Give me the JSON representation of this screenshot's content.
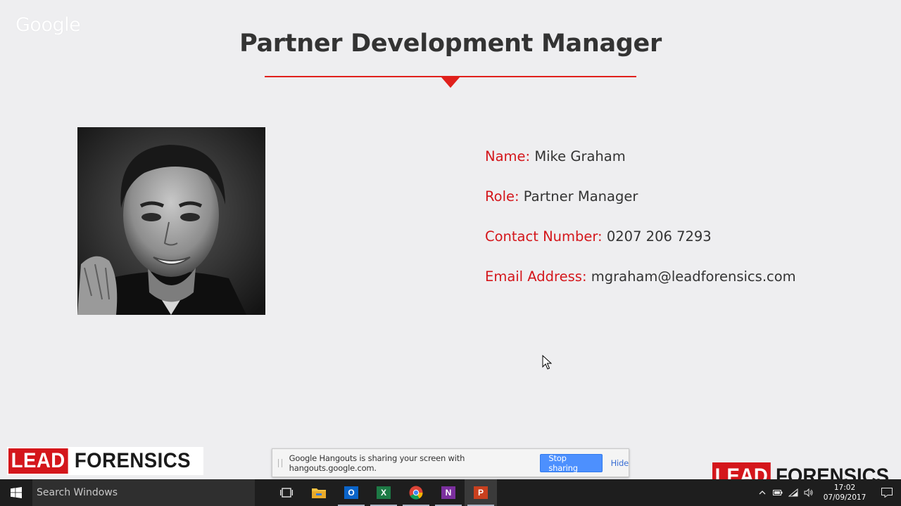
{
  "watermark": "Google",
  "slide": {
    "title": "Partner Development Manager",
    "details": [
      {
        "label": "Name:",
        "value": "Mike Graham"
      },
      {
        "label": "Role:",
        "value": "Partner Manager"
      },
      {
        "label": "Contact Number:",
        "value": "0207 206 7293"
      },
      {
        "label": "Email Address:",
        "value": "mgraham@leadforensics.com"
      }
    ]
  },
  "logo": {
    "lead": "LEAD",
    "forensics": "FORENSICS"
  },
  "share_bar": {
    "message": "Google Hangouts is sharing your screen with hangouts.google.com.",
    "stop_label": "Stop sharing",
    "hide_label": "Hide"
  },
  "taskbar": {
    "search_placeholder": "Search Windows",
    "apps": [
      "task-view-icon",
      "file-explorer-icon",
      "outlook-icon",
      "excel-icon",
      "chrome-icon",
      "onenote-icon",
      "powerpoint-icon"
    ],
    "clock_time": "17:02",
    "clock_date": "07/09/2017"
  },
  "colors": {
    "accent_red": "#d4161b",
    "title_text": "#333333",
    "share_button": "#4d90fe"
  }
}
